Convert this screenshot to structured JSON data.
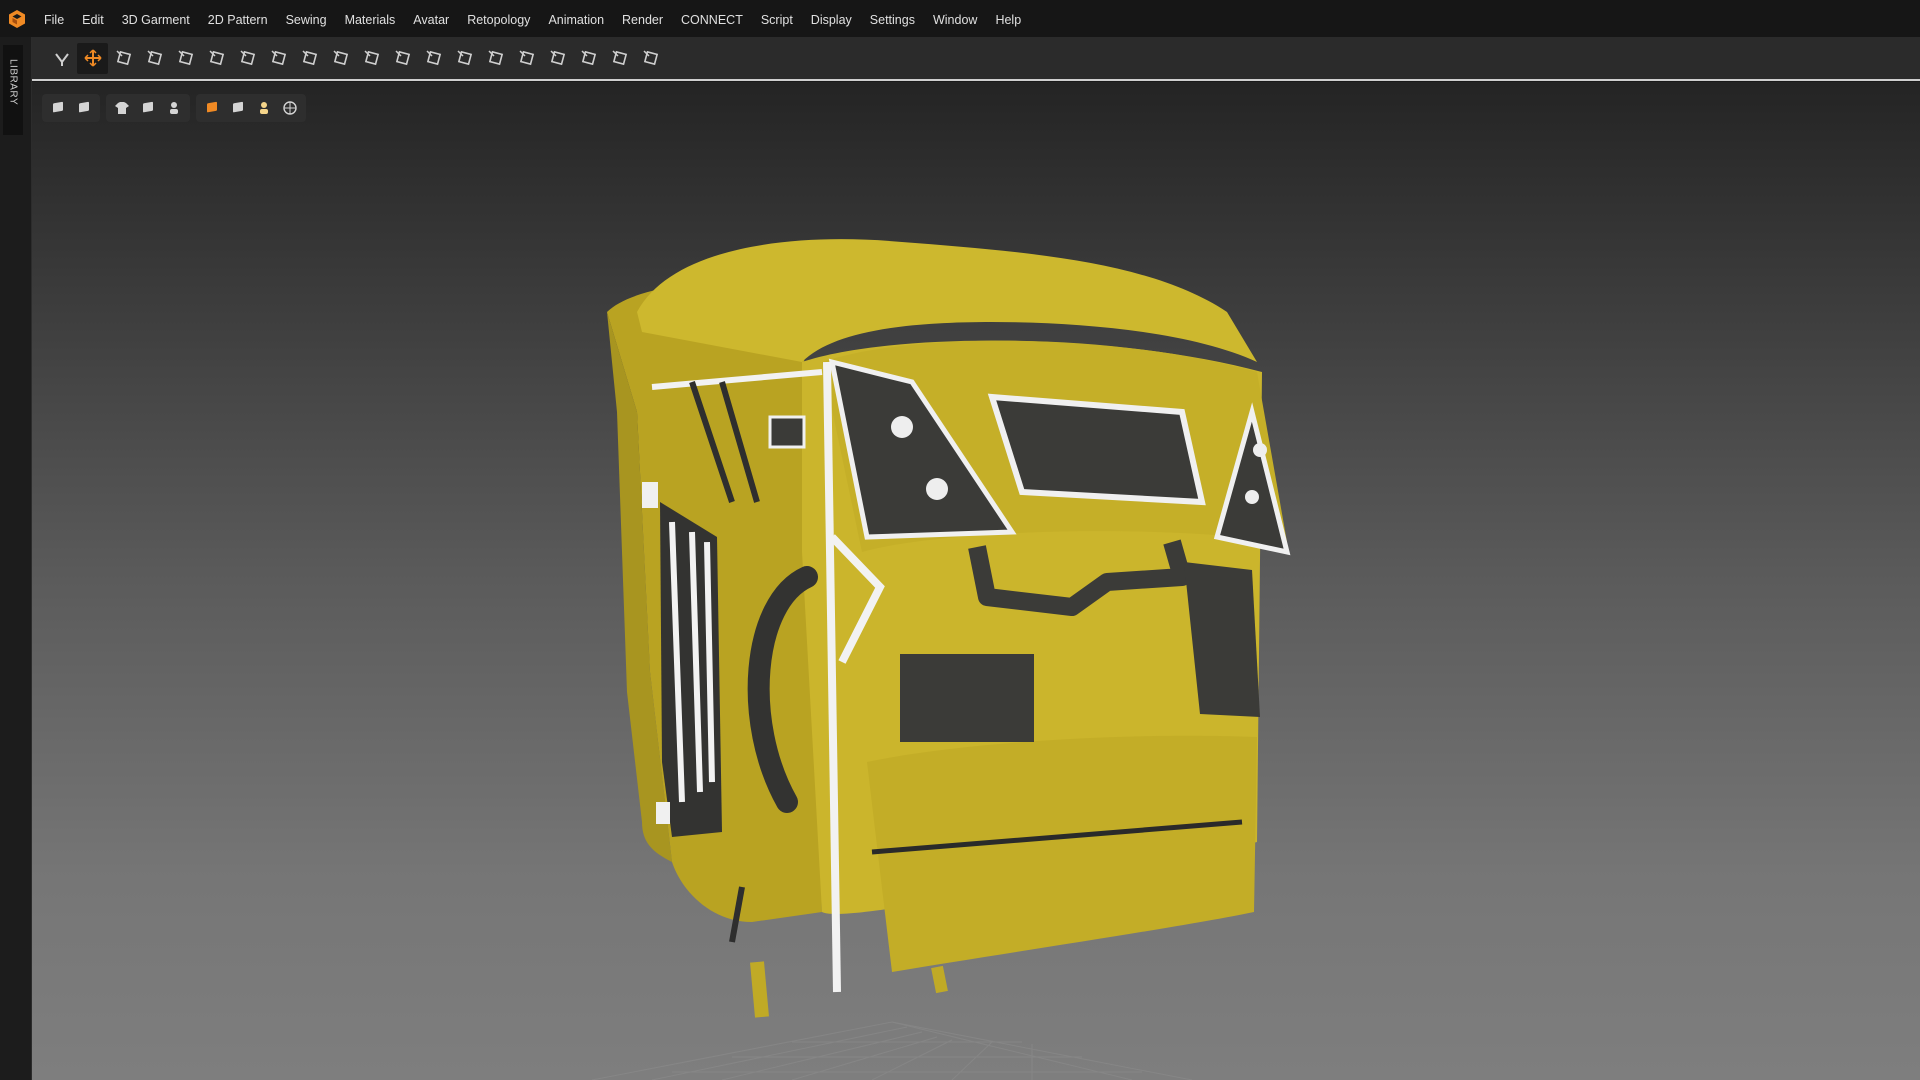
{
  "app": {
    "logo_icon": "clo-logo-icon",
    "accent": "#f08a24"
  },
  "menu": [
    {
      "label": "File"
    },
    {
      "label": "Edit"
    },
    {
      "label": "3D Garment"
    },
    {
      "label": "2D Pattern"
    },
    {
      "label": "Sewing"
    },
    {
      "label": "Materials"
    },
    {
      "label": "Avatar"
    },
    {
      "label": "Retopology"
    },
    {
      "label": "Animation"
    },
    {
      "label": "Render"
    },
    {
      "label": "CONNECT"
    },
    {
      "label": "Script"
    },
    {
      "label": "Display"
    },
    {
      "label": "Settings"
    },
    {
      "label": "Window"
    },
    {
      "label": "Help"
    }
  ],
  "library": {
    "label": "LIBRARY"
  },
  "toolbar": {
    "tools": [
      {
        "icon": "simulation-icon"
      },
      {
        "icon": "move-select-icon",
        "active": true
      },
      {
        "icon": "select-mesh-icon"
      },
      {
        "icon": "brush-icon"
      },
      {
        "icon": "fold-arrangement-icon"
      },
      {
        "icon": "tack-icon"
      },
      {
        "icon": "garment-fit-icon"
      },
      {
        "icon": "pin-icon"
      },
      {
        "icon": "arrangement-point-icon"
      },
      {
        "icon": "edit-pattern-icon"
      },
      {
        "icon": "grid-mesh-icon"
      },
      {
        "icon": "steam-icon"
      },
      {
        "icon": "shrink-icon"
      },
      {
        "icon": "sphere-pin-icon"
      },
      {
        "icon": "measure-icon"
      },
      {
        "icon": "zipper-icon"
      },
      {
        "icon": "puckering-icon"
      },
      {
        "icon": "piping-icon"
      },
      {
        "icon": "curve-icon"
      },
      {
        "icon": "avatar-pose-icon"
      }
    ]
  },
  "view_controls": {
    "groups": [
      [
        "box-view-icon",
        "box-wire-icon"
      ],
      [
        "garment-icon",
        "avatar-measure-icon",
        "avatar-icon"
      ],
      [
        "texture-icon",
        "shading-icon",
        "light-icon",
        "globe-icon"
      ]
    ]
  },
  "scene": {
    "object": "yellow backpack 3D garment",
    "body_color": "#cbb52c",
    "panel_color": "#3b3b38",
    "trim_color": "#f0f0f0"
  }
}
